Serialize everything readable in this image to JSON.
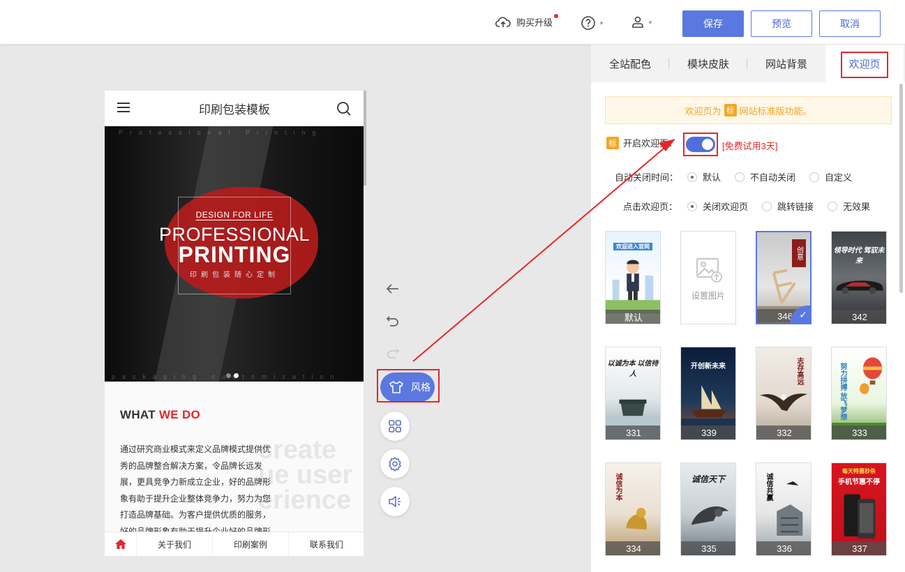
{
  "topbar": {
    "upgrade_label": "购买升级",
    "save_label": "保存",
    "preview_label": "预览",
    "cancel_label": "取消"
  },
  "phone": {
    "title": "印刷包装模板",
    "banner": {
      "line1": "DESIGN FOR LIFE",
      "line2": "PROFESSIONAL",
      "line3": "PRINTING",
      "line4": "印刷包装随心定制",
      "top_text": "Professional Printing",
      "bottom_text": "packaging customization"
    },
    "what_heading_a": "WHAT ",
    "what_heading_b": "WE DO",
    "bg_text": "create\nue user\nerience",
    "paragraph": "通过研究商业模式来定义品牌模式提供优秀的品牌整合解决方案，令品牌长远发展，更具竞争力新成立企业，好的品牌形象有助于提升企业整体竞争力，努力为您打造品牌基础。为客户提供优质的服务，好的品牌形象有助于提升企业好的品牌形",
    "footer": [
      "关于我们",
      "印刷案例",
      "联系我们"
    ]
  },
  "tools": {
    "style_label": "风格"
  },
  "panel": {
    "tabs": [
      "全站配色",
      "模块皮肤",
      "网站背景",
      "欢迎页"
    ],
    "notice_a": "欢迎页为",
    "notice_badge": "标",
    "notice_b": "网站标准版功能。",
    "enable_label": "开启欢迎页：",
    "trial_label": "[免费试用3天]",
    "auto_close_label": "自动关闭时间：",
    "auto_close_options": [
      "默认",
      "不自动关闭",
      "自定义"
    ],
    "click_label": "点击欢迎页：",
    "click_options": [
      "关闭欢迎页",
      "跳转链接",
      "无效果"
    ],
    "set_image_label": "设置图片",
    "thumbs": [
      "默认",
      "346",
      "342",
      "331",
      "339",
      "332",
      "333",
      "334",
      "335",
      "336",
      "337"
    ],
    "thumb_texts": {
      "default_top": "欢迎进入官网",
      "t346": "创意",
      "t342": "领导时代 驾驭未来",
      "t331": "以诚为本 以信待人",
      "t339": "开创新未来",
      "t332": "志存高远",
      "t333": "努力拼搏 放飞梦想",
      "t334": "诚信为本",
      "t335": "诚信天下",
      "t336": "诚信共赢",
      "t337_a": "每天特惠秒杀",
      "t337_b": "手机节惠不停"
    }
  }
}
